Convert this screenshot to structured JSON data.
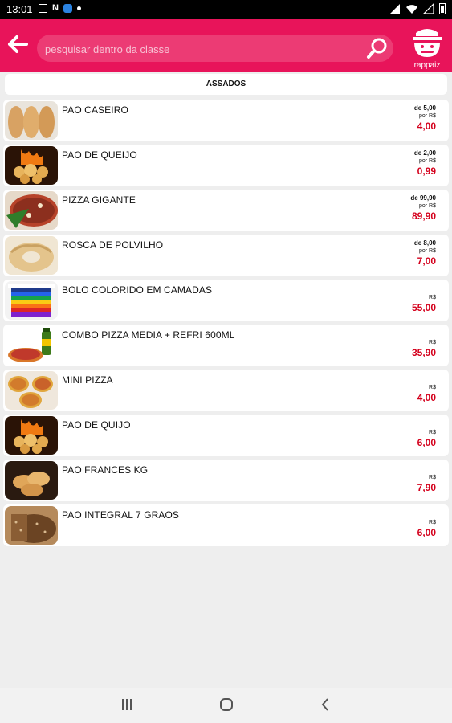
{
  "status_bar": {
    "time": "13:01",
    "left_icons": [
      "image-icon",
      "n-icon",
      "app-icon",
      "dot-icon"
    ],
    "right_icons": [
      "signal-icon",
      "wifi-icon",
      "battery-icon"
    ]
  },
  "header": {
    "search": {
      "placeholder": "pesquisar dentro da classe",
      "value": ""
    },
    "logo_text": "rappaiz",
    "accent": "#e8145a"
  },
  "category": {
    "title": "ASSADOS"
  },
  "products": [
    {
      "name": "PAO CASEIRO",
      "was": "de 5,00",
      "per": "por R$",
      "price": "4,00",
      "thumb": "bread"
    },
    {
      "name": "PAO DE QUEIJO",
      "was": "de 2,00",
      "per": "por R$",
      "price": "0,99",
      "thumb": "cheese-bread"
    },
    {
      "name": "PIZZA GIGANTE",
      "was": "de 99,90",
      "per": "por R$",
      "price": "89,90",
      "thumb": "pizza-big"
    },
    {
      "name": "ROSCA DE POLVILHO",
      "was": "de 8,00",
      "per": "por R$",
      "price": "7,00",
      "thumb": "rosca"
    },
    {
      "name": "BOLO COLORIDO EM CAMADAS",
      "was": "",
      "per": "R$",
      "price": "55,00",
      "thumb": "cake"
    },
    {
      "name": "COMBO PIZZA MEDIA + REFRI 600ML",
      "was": "",
      "per": "R$",
      "price": "35,90",
      "thumb": "combo"
    },
    {
      "name": "MINI PIZZA",
      "was": "",
      "per": "R$",
      "price": "4,00",
      "thumb": "mini-pizza"
    },
    {
      "name": "PAO DE QUIJO",
      "was": "",
      "per": "R$",
      "price": "6,00",
      "thumb": "cheese-bread"
    },
    {
      "name": "PAO FRANCES KG",
      "was": "",
      "per": "R$",
      "price": "7,90",
      "thumb": "french-bread"
    },
    {
      "name": "PAO INTEGRAL 7 GRAOS",
      "was": "",
      "per": "R$",
      "price": "6,00",
      "thumb": "whole-bread"
    }
  ],
  "nav": {
    "buttons": [
      "recents-icon",
      "home-icon",
      "back-nav-icon"
    ]
  }
}
